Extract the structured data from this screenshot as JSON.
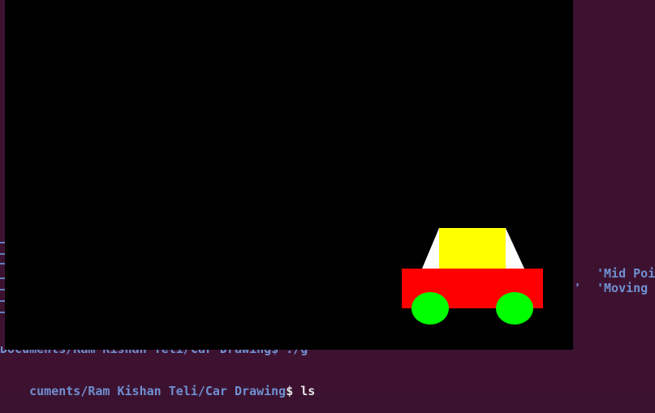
{
  "terminal": {
    "background": "#3d1230",
    "prompt_path_partial": "cuments/Ram Kishan Teli/Car Drawing",
    "prompt_symbol": "$",
    "command": " ls",
    "obscured_line_fragment": "Documents/Ram Kishan Teli/Car Drawing$ ./g",
    "right_text_1": "'Mid Poi",
    "right_text_2": "'Moving c",
    "right_quote": "'"
  },
  "graphics_window": {
    "background": "#000000"
  },
  "car": {
    "body_color": "#ff0000",
    "cabin_color": "#ffff00",
    "window_color": "#ffffff",
    "wheel_color": "#00ff00"
  }
}
